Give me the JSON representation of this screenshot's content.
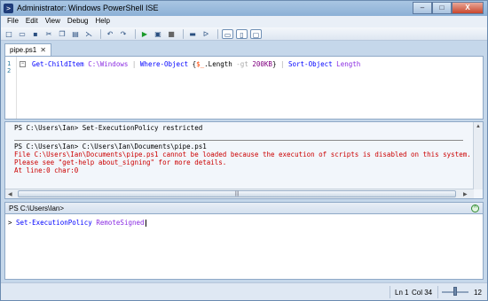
{
  "window": {
    "title": "Administrator: Windows PowerShell ISE",
    "app_icon": "powershell-icon",
    "controls": {
      "minimize": "–",
      "maximize": "□",
      "close": "X"
    }
  },
  "menubar": {
    "items": [
      "File",
      "Edit",
      "View",
      "Debug",
      "Help"
    ]
  },
  "toolbar": {
    "icons": [
      "new-icon",
      "open-icon",
      "save-icon",
      "cut-icon",
      "copy-icon",
      "paste-icon",
      "clear-icon",
      "undo-icon",
      "redo-icon",
      "run-icon",
      "run-selection-icon",
      "stop-icon",
      "new-remote-tab-icon",
      "powershell-icon",
      "layout-script-top-icon",
      "layout-script-right-icon",
      "layout-script-max-icon"
    ],
    "glyphs": {
      "new": "□",
      "open": "▭",
      "save": "▪",
      "cut": "✂",
      "copy": "❐",
      "paste": "▤",
      "clear": "⋋",
      "undo": "↶",
      "redo": "↷",
      "run": "▶",
      "runsel": "▣",
      "stop": "■",
      "remote": "▬",
      "ps": "ᐅ",
      "layout1": "▭",
      "layout2": "▯",
      "layout3": "▢"
    }
  },
  "editor": {
    "tab": {
      "label": "pipe.ps1",
      "close": "✕"
    },
    "line_numbers": [
      "1",
      "2"
    ],
    "collapse_glyph": "−",
    "code": {
      "cmd1": "Get-ChildItem",
      "arg1": " C:\\Windows",
      "pipe1": " | ",
      "cmd2": "Where-Object",
      "brace_open": " {",
      "var": "$_",
      "member": ".Length",
      "op": " -gt ",
      "num": "200KB",
      "brace_close": "}",
      "pipe2": " | ",
      "cmd3": "Sort-Object",
      "arg3": " Length"
    }
  },
  "output": {
    "lines": [
      "PS C:\\Users\\Ian> Set-ExecutionPolicy restricted",
      "PS C:\\Users\\Ian> C:\\Users\\Ian\\Documents\\pipe.ps1"
    ],
    "errors": [
      "File C:\\Users\\Ian\\Documents\\pipe.ps1 cannot be loaded because the execution of scripts is disabled on this system.",
      "Please see \"get-help about_signing\" for more details.",
      "At line:0 char:0"
    ],
    "scroll_grip": "|||"
  },
  "command": {
    "prompt_header": "PS C:\\Users\\Ian>",
    "prompt_symbol": ">",
    "input_cmd": "Set-ExecutionPolicy",
    "input_arg": " RemoteSigned",
    "collapse_glyph": "^"
  },
  "status": {
    "ln": "Ln 1",
    "col": "Col 34",
    "zoom": "12"
  }
}
